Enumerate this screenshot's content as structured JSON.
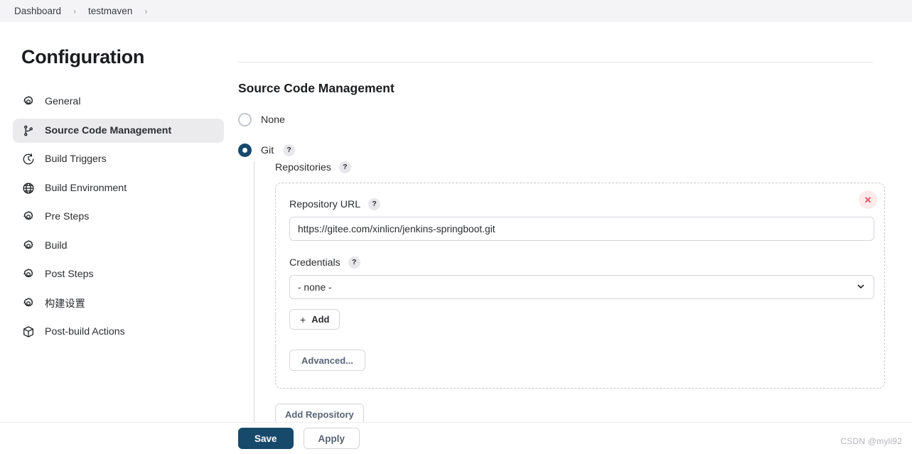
{
  "breadcrumb": {
    "items": [
      "Dashboard",
      "testmaven"
    ],
    "separator": "›"
  },
  "sidebar": {
    "title": "Configuration",
    "items": [
      {
        "label": "General",
        "icon": "gear-icon",
        "active": false
      },
      {
        "label": "Source Code Management",
        "icon": "git-branch-icon",
        "active": true
      },
      {
        "label": "Build Triggers",
        "icon": "clock-icon",
        "active": false
      },
      {
        "label": "Build Environment",
        "icon": "globe-icon",
        "active": false
      },
      {
        "label": "Pre Steps",
        "icon": "gear-icon",
        "active": false
      },
      {
        "label": "Build",
        "icon": "gear-icon",
        "active": false
      },
      {
        "label": "Post Steps",
        "icon": "gear-icon",
        "active": false
      },
      {
        "label": "构建设置",
        "icon": "gear-icon",
        "active": false
      },
      {
        "label": "Post-build Actions",
        "icon": "package-icon",
        "active": false
      }
    ]
  },
  "main": {
    "section_title": "Source Code Management",
    "scm_options": [
      {
        "label": "None",
        "selected": false,
        "help": false
      },
      {
        "label": "Git",
        "selected": true,
        "help": true
      }
    ],
    "repositories_label": "Repositories",
    "repository": {
      "url_label": "Repository URL",
      "url_value": "https://gitee.com/xinlicn/jenkins-springboot.git",
      "credentials_label": "Credentials",
      "credentials_value": "- none -",
      "add_credentials_label": "Add",
      "add_credentials_plus": "+",
      "advanced_label": "Advanced...",
      "delete_icon": "✕"
    },
    "add_repository_label": "Add Repository",
    "help_glyph": "?"
  },
  "footer": {
    "save_label": "Save",
    "apply_label": "Apply",
    "watermark": "CSDN @myli92"
  },
  "colors": {
    "accent": "#17496b",
    "header_bg": "#f4f4f6",
    "active_nav_bg": "#ebebee",
    "danger": "#e05260",
    "danger_bg": "#fdebec"
  }
}
